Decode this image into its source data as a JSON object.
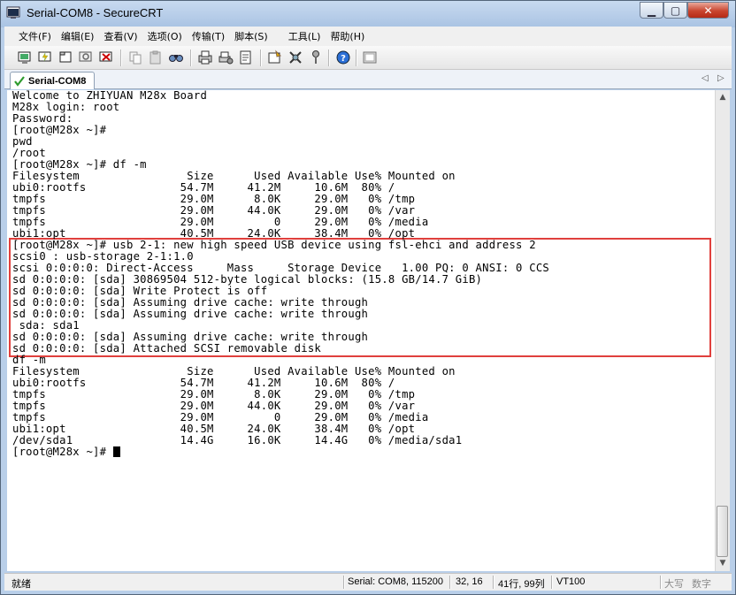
{
  "window": {
    "title": "Serial-COM8 - SecureCRT"
  },
  "menu": [
    "文件(F)",
    "编辑(E)",
    "查看(V)",
    "选项(O)",
    "传输(T)",
    "脚本(S)",
    "工具(L)",
    "帮助(H)"
  ],
  "toolbar_icons": [
    "connect-icon",
    "quick-connect-icon",
    "connect-tab-icon",
    "reconnect-icon",
    "disconnect-icon",
    "copy-icon",
    "paste-icon",
    "find-icon",
    "print-icon",
    "print-setup-icon",
    "log-session-icon",
    "session-options-icon",
    "keymap-icon",
    "key-icon",
    "help-icon",
    "sftp-icon"
  ],
  "tab": {
    "label": "Serial-COM8"
  },
  "terminal": {
    "lines": [
      "Welcome to ZHIYUAN M28x Board",
      "M28x login: root",
      "Password:",
      "[root@M28x ~]#",
      "pwd",
      "/root",
      "[root@M28x ~]# df -m",
      "Filesystem                Size      Used Available Use% Mounted on",
      "ubi0:rootfs              54.7M     41.2M     10.6M  80% /",
      "tmpfs                    29.0M      8.0K     29.0M   0% /tmp",
      "tmpfs                    29.0M     44.0K     29.0M   0% /var",
      "tmpfs                    29.0M         0     29.0M   0% /media",
      "ubi1:opt                 40.5M     24.0K     38.4M   0% /opt",
      "[root@M28x ~]# usb 2-1: new high speed USB device using fsl-ehci and address 2",
      "scsi0 : usb-storage 2-1:1.0",
      "scsi 0:0:0:0: Direct-Access     Mass     Storage Device   1.00 PQ: 0 ANSI: 0 CCS",
      "sd 0:0:0:0: [sda] 30869504 512-byte logical blocks: (15.8 GB/14.7 GiB)",
      "sd 0:0:0:0: [sda] Write Protect is off",
      "sd 0:0:0:0: [sda] Assuming drive cache: write through",
      "sd 0:0:0:0: [sda] Assuming drive cache: write through",
      " sda: sda1",
      "sd 0:0:0:0: [sda] Assuming drive cache: write through",
      "sd 0:0:0:0: [sda] Attached SCSI removable disk",
      "df -m",
      "Filesystem                Size      Used Available Use% Mounted on",
      "ubi0:rootfs              54.7M     41.2M     10.6M  80% /",
      "tmpfs                    29.0M      8.0K     29.0M   0% /tmp",
      "tmpfs                    29.0M     44.0K     29.0M   0% /var",
      "tmpfs                    29.0M         0     29.0M   0% /media",
      "ubi1:opt                 40.5M     24.0K     38.4M   0% /opt",
      "/dev/sda1                14.4G     16.0K     14.4G   0% /media/sda1",
      "[root@M28x ~]# "
    ]
  },
  "status": {
    "ready": "就绪",
    "connection": "Serial: COM8, 115200",
    "cursor_pos": "32, 16",
    "size": "41行, 99列",
    "emulation": "VT100",
    "caps": "大写",
    "num": "数字"
  },
  "colors": {
    "highlight_border": "#e0403d",
    "terminal_bg": "#ffffff",
    "terminal_fg": "#000000"
  }
}
